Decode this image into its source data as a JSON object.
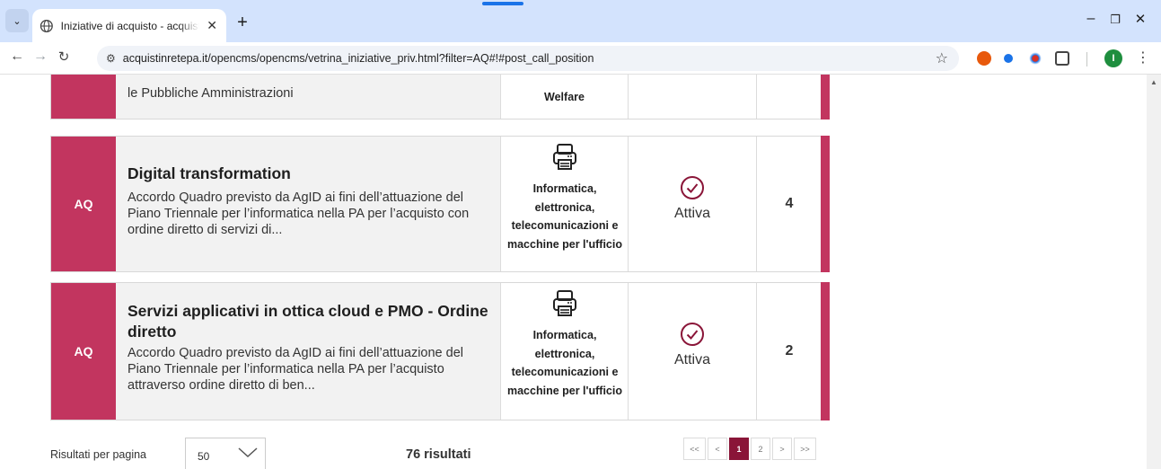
{
  "browser": {
    "tab_title": "Iniziative di acquisto - acquistinretepa",
    "url": "acquistinretepa.it/opencms/opencms/vetrina_iniziative_priv.html?filter=AQ#!#post_call_position",
    "profile_initial": "I"
  },
  "partial_card": {
    "desc_tail": "le Pubbliche Amministrazioni",
    "cat_tail": "Welfare"
  },
  "cards": [
    {
      "type": "AQ",
      "title": "Digital transformation",
      "description": "Accordo Quadro previsto da AgID ai fini dell’attuazione del Piano Triennale per l’informatica nella PA per l’acquisto con ordine diretto di servizi di...",
      "category": "Informatica, elettronica, telecomunicazioni e macchine per l'ufficio",
      "status": "Attiva",
      "count": "4"
    },
    {
      "type": "AQ",
      "title": "Servizi applicativi in ottica cloud e PMO - Ordine diretto",
      "description": "Accordo Quadro previsto da AgID ai fini dell’attuazione del Piano Triennale per l’informatica nella PA per l’acquisto attraverso ordine diretto di ben...",
      "category": "Informatica, elettronica, telecomunicazioni e macchine per l'ufficio",
      "status": "Attiva",
      "count": "2"
    }
  ],
  "footer": {
    "results_per_page_label": "Risultati per pagina",
    "results_per_page_value": "50",
    "total_results": "76 risultati",
    "pagination": [
      "<<",
      "<",
      "1",
      "2",
      ">",
      ">>"
    ],
    "current_page": "1"
  },
  "colors": {
    "accent": "#c2355f",
    "status_icon": "#8a1538"
  }
}
